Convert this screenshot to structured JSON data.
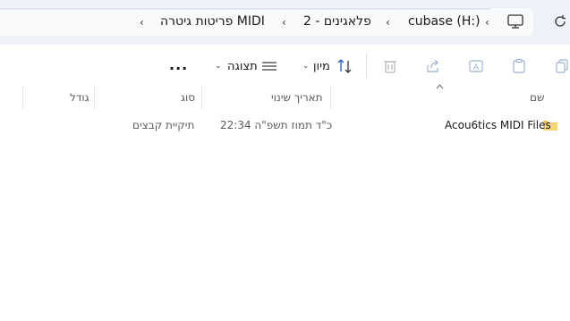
{
  "breadcrumb": {
    "items": [
      "cubase (H:)",
      "2 - פלאגינים",
      "פריטות גיטרה MIDI"
    ]
  },
  "toolbar": {
    "sort_label": "מיון",
    "view_label": "תצוגה",
    "more_label": "..."
  },
  "columns": {
    "name": "שם",
    "date": "תאריך שינוי",
    "type": "סוג",
    "size": "גודל"
  },
  "rows": [
    {
      "name": "Acou6tics MIDI Files",
      "date": "22:34 כ\"ד תמוז תשפ\"ה",
      "type": "תיקיית קבצים",
      "size": ""
    }
  ],
  "colors": {
    "topbar": "#eef2f8",
    "folder": "#f2c14e",
    "accent": "#1f5fb5"
  }
}
